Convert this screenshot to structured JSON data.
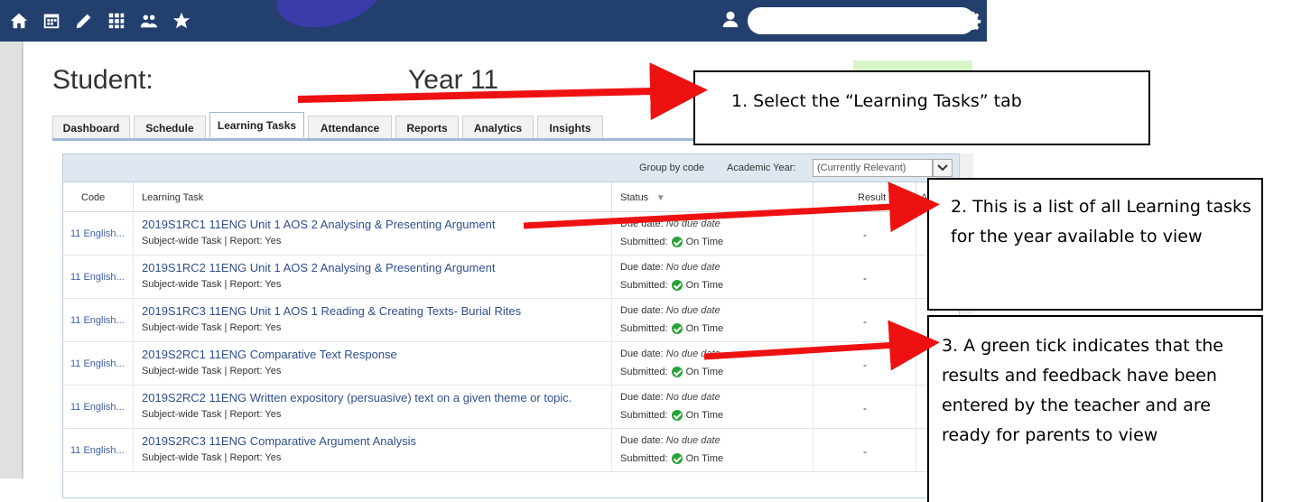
{
  "nav": {
    "icons": [
      "home-icon",
      "calendar-icon",
      "pencil-icon",
      "grid-icon",
      "people-icon",
      "star-icon"
    ],
    "user_icon": "user-icon",
    "settings_icon": "gear-icon"
  },
  "header": {
    "student_label": "Student:",
    "year_label": "Year 11"
  },
  "tabs": [
    {
      "label": "Dashboard"
    },
    {
      "label": "Schedule"
    },
    {
      "label": "Learning Tasks",
      "active": true
    },
    {
      "label": "Attendance"
    },
    {
      "label": "Reports"
    },
    {
      "label": "Analytics"
    },
    {
      "label": "Insights"
    }
  ],
  "toolbar": {
    "group_by": "Group by code",
    "academic_year_label": "Academic Year:",
    "academic_year_value": "(Currently Relevant)"
  },
  "columns": {
    "code": "Code",
    "task": "Learning Task",
    "status": "Status",
    "result": "Result",
    "extra": "Ac"
  },
  "rows": [
    {
      "code": "11 English...",
      "title": "2019S1RC1 11ENG Unit 1 AOS 2 Analysing & Presenting Argument",
      "meta_type": "Subject-wide Task",
      "meta_report_label": "Report:",
      "meta_report": "Yes",
      "due_label": "Due date:",
      "due": "No due date",
      "sub_label": "Submitted:",
      "sub": "On Time",
      "result": "-"
    },
    {
      "code": "11 English...",
      "title": "2019S1RC2 11ENG Unit 1 AOS 2 Analysing & Presenting Argument",
      "meta_type": "Subject-wide Task",
      "meta_report_label": "Report:",
      "meta_report": "Yes",
      "due_label": "Due date:",
      "due": "No due date",
      "sub_label": "Submitted:",
      "sub": "On Time",
      "result": "-"
    },
    {
      "code": "11 English...",
      "title": "2019S1RC3 11ENG Unit 1 AOS 1 Reading & Creating Texts- Burial Rites",
      "meta_type": "Subject-wide Task",
      "meta_report_label": "Report:",
      "meta_report": "Yes",
      "due_label": "Due date:",
      "due": "No due date",
      "sub_label": "Submitted:",
      "sub": "On Time",
      "result": "-"
    },
    {
      "code": "11 English...",
      "title": "2019S2RC1 11ENG Comparative Text Response",
      "meta_type": "Subject-wide Task",
      "meta_report_label": "Report:",
      "meta_report": "Yes",
      "due_label": "Due date:",
      "due": "No due date",
      "sub_label": "Submitted:",
      "sub": "On Time",
      "result": "-"
    },
    {
      "code": "11 English...",
      "title": "2019S2RC2 11ENG Written expository (persuasive) text on a given theme or topic.",
      "meta_type": "Subject-wide Task",
      "meta_report_label": "Report:",
      "meta_report": "Yes",
      "due_label": "Due date:",
      "due": "No due date",
      "sub_label": "Submitted:",
      "sub": "On Time",
      "result": "-"
    },
    {
      "code": "11 English...",
      "title": "2019S2RC3 11ENG Comparative Argument Analysis",
      "meta_type": "Subject-wide Task",
      "meta_report_label": "Report:",
      "meta_report": "Yes",
      "due_label": "Due date:",
      "due": "No due date",
      "sub_label": "Submitted:",
      "sub": "On Time",
      "result": "-"
    }
  ],
  "annotations": {
    "c1": "1.     Select the “Learning Tasks” tab",
    "c2": "2.  This is a list of all Learning tasks for the year available to view",
    "c3": "3.  A green tick indicates that the results and feedback have been entered by the teacher and are ready for parents to view",
    "arrow_color": "#ee1111"
  },
  "colors": {
    "nav_bg": "#223f6d",
    "link": "#2f4f8f",
    "tick": "#27a33a"
  }
}
